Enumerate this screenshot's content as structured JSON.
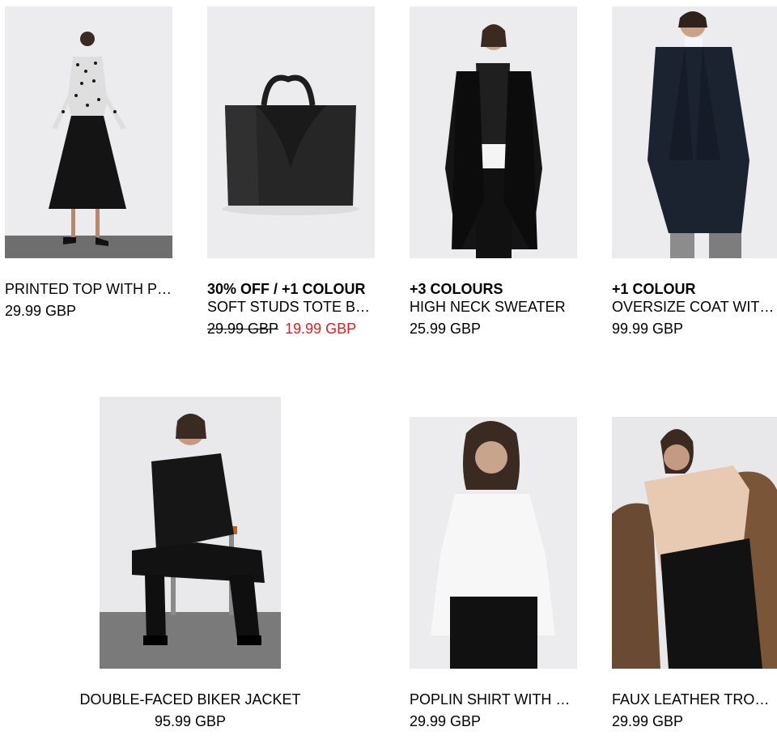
{
  "products": [
    {
      "promo": "",
      "name": "PRINTED TOP WITH PLEATED SKIRT",
      "price": "29.99 GBP"
    },
    {
      "promo": "30% OFF / +1 COLOUR",
      "name": "SOFT STUDS TOTE BAG",
      "old_price": "29.99 GBP",
      "new_price": "19.99 GBP"
    },
    {
      "promo": "+3 COLOURS",
      "name": "HIGH NECK SWEATER",
      "price": "25.99 GBP"
    },
    {
      "promo": "+1 COLOUR",
      "name": "OVERSIZE COAT WITH BELT",
      "price": "99.99 GBP"
    },
    {
      "promo": "",
      "name": "DOUBLE-FACED BIKER JACKET",
      "price": "95.99 GBP"
    },
    {
      "promo": "",
      "name": "POPLIN SHIRT WITH LACE TRIMS",
      "price": "29.99 GBP"
    },
    {
      "promo": "",
      "name": "FAUX LEATHER TROUSERS",
      "price": "29.99 GBP"
    }
  ],
  "colors": {
    "sale_price": "#e02020",
    "photo_background": "#e9e9eb"
  }
}
